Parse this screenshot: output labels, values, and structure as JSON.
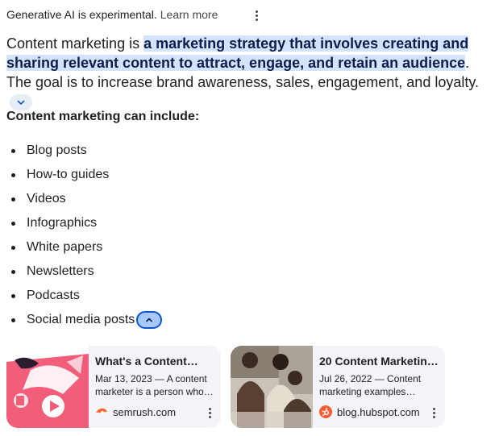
{
  "notice": {
    "text": "Generative AI is experimental.",
    "link": "Learn more",
    "menu_icon": "more-vert-icon"
  },
  "intro": {
    "before": "Content marketing is ",
    "highlight": "a marketing strategy that involves creating and sharing relevant content to attract, engage, and retain an audience",
    "after": ". The goal is to increase brand awareness, sales, engagement, and loyalty.",
    "expand_icon": "chevron-down-icon"
  },
  "list_heading": "Content marketing can include:",
  "list_items": [
    "Blog posts",
    "How-to guides",
    "Videos",
    "Infographics",
    "White papers",
    "Newsletters",
    "Podcasts",
    "Social media posts"
  ],
  "collapse_icon": "chevron-up-icon",
  "sources": [
    {
      "title": "What's a Content…",
      "snippet": "Mar 13, 2023 — A content marketer is a person who…",
      "domain": "semrush.com",
      "favicon": "semrush-flame-icon",
      "favicon_color": "#ff642d"
    },
    {
      "title": "20 Content Marketin…",
      "snippet": "Jul 26, 2022 — Content marketing examples…",
      "domain": "blog.hubspot.com",
      "favicon": "hubspot-sprocket-icon",
      "favicon_color": "#ff5c35"
    }
  ],
  "colors": {
    "highlight_bg": "#d3e3fd",
    "accent_blue": "#0b57d0",
    "card_bg": "#f3f5f8",
    "thumb1_pink": "#f25d7a"
  }
}
